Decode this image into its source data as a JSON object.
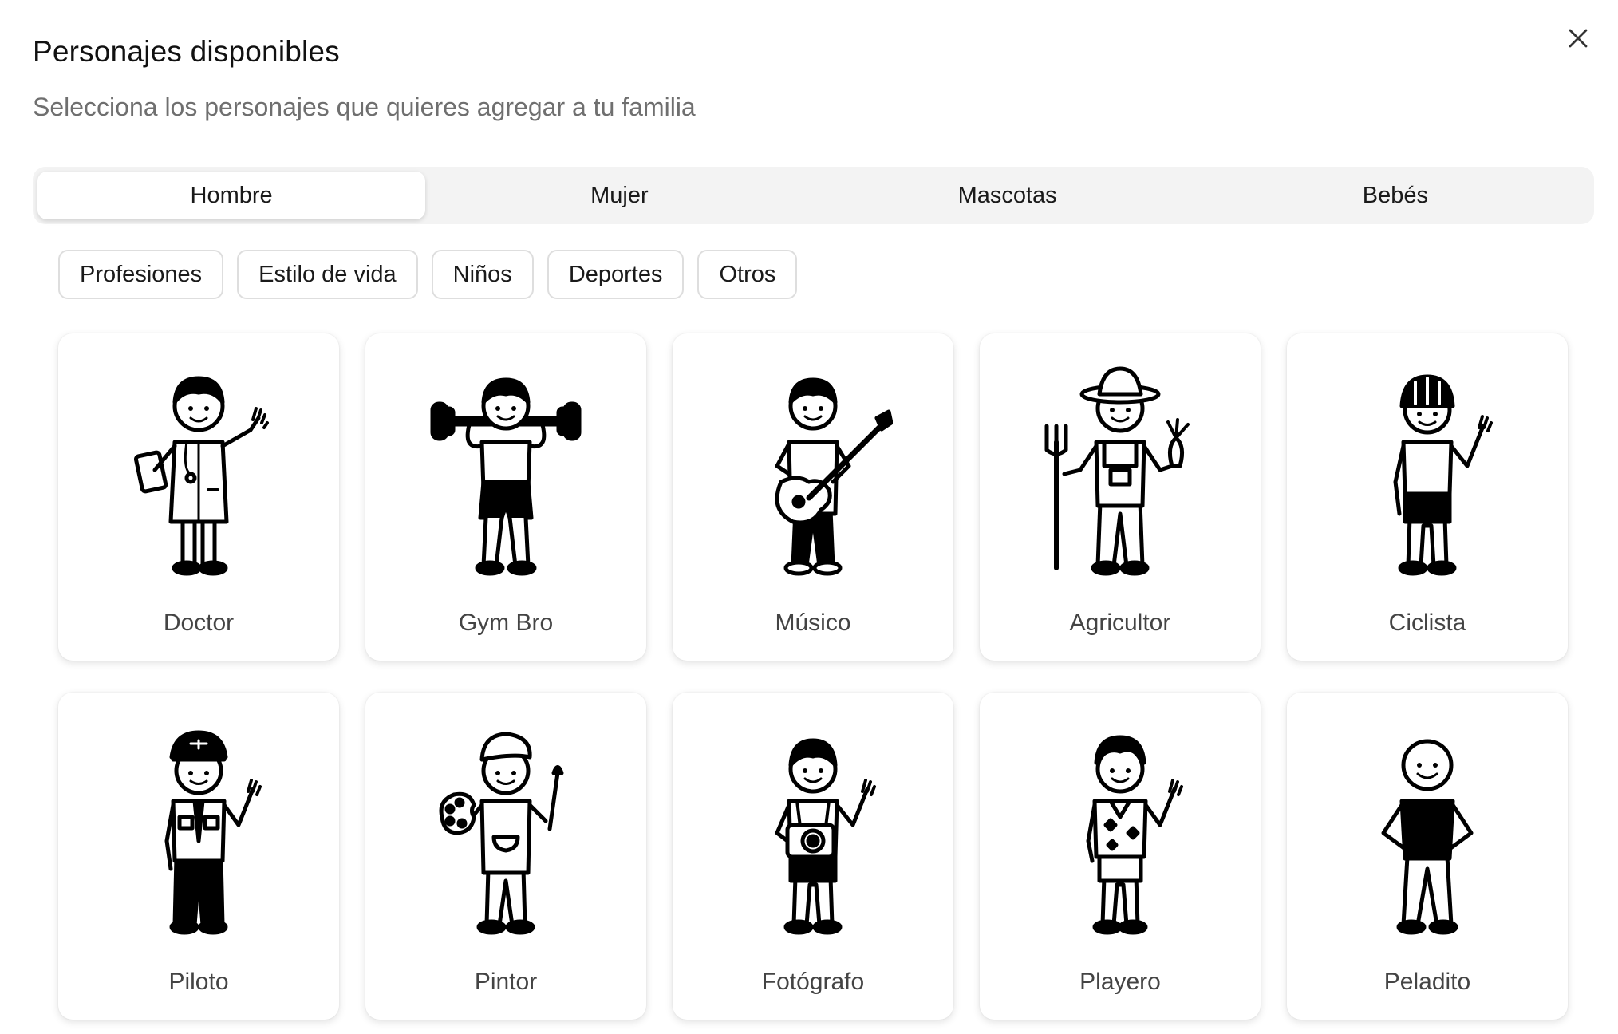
{
  "dialog": {
    "title": "Personajes disponibles",
    "subtitle": "Selecciona los personajes que quieres agregar a tu familia",
    "close_icon": "close-icon"
  },
  "tabs": [
    {
      "label": "Hombre",
      "active": true
    },
    {
      "label": "Mujer",
      "active": false
    },
    {
      "label": "Mascotas",
      "active": false
    },
    {
      "label": "Bebés",
      "active": false
    }
  ],
  "filters": [
    {
      "label": "Profesiones"
    },
    {
      "label": "Estilo de vida"
    },
    {
      "label": "Niños"
    },
    {
      "label": "Deportes"
    },
    {
      "label": "Otros"
    }
  ],
  "characters": [
    {
      "name": "Doctor",
      "icon": "doctor-figure-icon"
    },
    {
      "name": "Gym Bro",
      "icon": "gym-bro-figure-icon"
    },
    {
      "name": "Músico",
      "icon": "musician-figure-icon"
    },
    {
      "name": "Agricultor",
      "icon": "farmer-figure-icon"
    },
    {
      "name": "Ciclista",
      "icon": "cyclist-figure-icon"
    },
    {
      "name": "Piloto",
      "icon": "pilot-figure-icon"
    },
    {
      "name": "Pintor",
      "icon": "painter-figure-icon"
    },
    {
      "name": "Fotógrafo",
      "icon": "photographer-figure-icon"
    },
    {
      "name": "Playero",
      "icon": "beach-figure-icon"
    },
    {
      "name": "Peladito",
      "icon": "bald-figure-icon"
    }
  ],
  "colors": {
    "background": "#ffffff",
    "tab_track": "#f3f3f3",
    "subtitle": "#6f6f6f",
    "card_label": "#444444",
    "chip_border": "#dedede"
  }
}
